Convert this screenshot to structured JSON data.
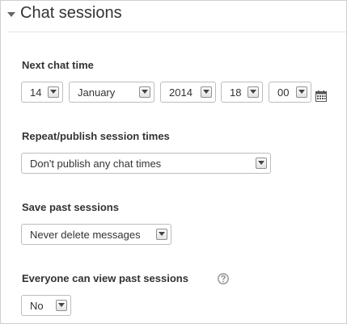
{
  "section": {
    "title": "Chat sessions",
    "icon": "collapse-caret-icon"
  },
  "next_chat_time": {
    "label": "Next chat time",
    "day": "14",
    "month": "January",
    "year": "2014",
    "hour": "18",
    "minute": "00",
    "calendar_icon": "calendar-icon"
  },
  "repeat": {
    "label": "Repeat/publish session times",
    "value": "Don't publish any chat times"
  },
  "save_past": {
    "label": "Save past sessions",
    "value": "Never delete messages"
  },
  "everyone_view": {
    "label": "Everyone can view past sessions",
    "value": "No",
    "help_icon": "help-icon"
  }
}
